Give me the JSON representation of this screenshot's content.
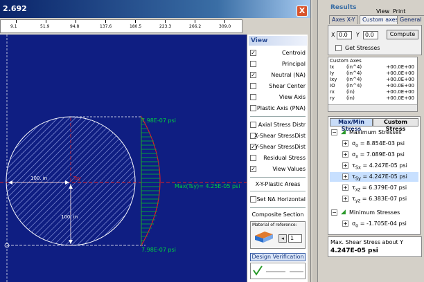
{
  "window": {
    "title": "2.692",
    "close_label": "X"
  },
  "ruler": {
    "ticks": [
      "9.1",
      "51.9",
      "94.8",
      "137.6",
      "180.5",
      "223.3",
      "266.2",
      "309.0"
    ]
  },
  "canvas": {
    "dim_horizontal": "100. in",
    "dim_vertical": "100. in",
    "centroid_label": "Tsy",
    "top_value": "7.98E-07 psi",
    "bottom_value": "7.98E-07 psi",
    "max_label": "Max(Tsy)= 4.25E-05 psi"
  },
  "view_panel": {
    "header": "View",
    "options": [
      {
        "label": "Centroid",
        "checked": true
      },
      {
        "label": "Principal",
        "checked": false
      },
      {
        "label": "Neutral (NA)",
        "checked": true
      },
      {
        "label": "Shear Center",
        "checked": false
      },
      {
        "label": "View Axis",
        "checked": false
      },
      {
        "label": "Plastic Axis (PNA)",
        "checked": false
      }
    ],
    "stress_options": [
      {
        "label": "Axial Stress Distr",
        "checked": false
      },
      {
        "label": "X-Shear StressDist",
        "checked": false
      },
      {
        "label": "Y-Shear StressDist",
        "checked": true
      },
      {
        "label": "Residual Stress",
        "checked": false
      },
      {
        "label": "View Values",
        "checked": true
      }
    ],
    "plastic_areas": "X-Y-Plastic Areas",
    "set_na": {
      "label": "Set NA Horizontal",
      "checked": false
    },
    "composite_title": "Composite Section",
    "material_ref_label": "Material of reference:",
    "material_ref_value": "1",
    "design_verification": "Design Verification"
  },
  "right_panel": {
    "results_label": "Results",
    "view_menu": "View",
    "print_menu": "Print",
    "tabs": [
      "Axes X-Y",
      "Custom axes",
      "General"
    ],
    "x_label": "X",
    "x_value": "0.0",
    "y_label": "Y",
    "y_value": "0.0",
    "compute_label": "Compute",
    "get_stresses_label": "Get Stresses",
    "custom_axes_title": "Custom Axes",
    "custom_axes_rows": [
      {
        "key": "Ix",
        "unit": "(in^4)",
        "value": "+00.0E+00"
      },
      {
        "key": "Iy",
        "unit": "(in^4)",
        "value": "+00.0E+00"
      },
      {
        "key": "Ixy",
        "unit": "(in^4)",
        "value": "+00.0E+00"
      },
      {
        "key": "IO",
        "unit": "(in^4)",
        "value": "+00.0E+00"
      },
      {
        "key": "rx",
        "unit": "(in)",
        "value": "+00.0E+00"
      },
      {
        "key": "ry",
        "unit": "(in)",
        "value": "+00.0E+00"
      }
    ],
    "stress_tabs": [
      "Max/Min Stress",
      "Custom Stress"
    ],
    "max_header": "Maximum Stresses",
    "max_items": [
      {
        "sym": "σ",
        "sub": "o",
        "value": "8.854E-03 psi"
      },
      {
        "sym": "σ",
        "sub": "x",
        "value": "7.089E-03 psi"
      },
      {
        "sym": "τ",
        "sub": "Sx",
        "value": "4.247E-05 psi"
      },
      {
        "sym": "τ",
        "sub": "Sy",
        "value": "4.247E-05 psi"
      },
      {
        "sym": "τ",
        "sub": "xz",
        "value": "6.379E-07 psi"
      },
      {
        "sym": "τ",
        "sub": "yz",
        "value": "6.383E-07 psi"
      }
    ],
    "min_header": "Minimum Stresses",
    "min_items": [
      {
        "sym": "σ",
        "sub": "o",
        "value": "-1.705E-04 psi"
      }
    ],
    "status_title": "Max. Shear Stress about Y",
    "status_value": "4.247E-05 psi"
  },
  "colors": {
    "canvas_bg": "#0f1e82",
    "section_fill": "#ffffff",
    "stress_fill": "#00a040",
    "stress_curve": "#e02020",
    "value_text": "#00d040",
    "tree_highlight": "#c8e0ff"
  }
}
